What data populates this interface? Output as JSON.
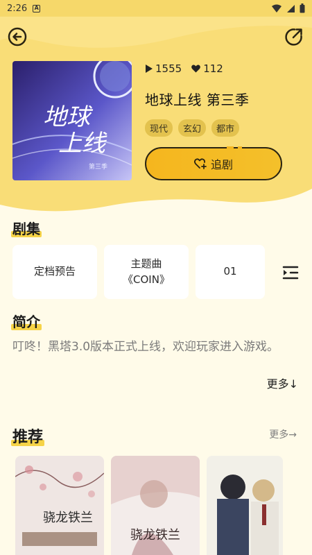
{
  "status_bar": {
    "time": "2:26",
    "notification_glyph": "A"
  },
  "header": {
    "back_icon": "back-arrow-circle-icon",
    "share_icon": "share-out-icon"
  },
  "drama": {
    "plays": "1555",
    "likes": "112",
    "title": "地球上线 第三季",
    "tags": [
      "现代",
      "玄幻",
      "都市"
    ],
    "follow_label": "追剧",
    "cover_text": [
      "地球",
      "上线"
    ],
    "cover_caption": "第三季"
  },
  "episodes": {
    "heading": "剧集",
    "items": [
      {
        "line1": "定档预告",
        "line2": ""
      },
      {
        "line1": "主题曲",
        "line2": "《COIN》"
      },
      {
        "line1": "01",
        "line2": ""
      }
    ]
  },
  "intro": {
    "heading": "简介",
    "text": "叮咚！黑塔3.0版本正式上线，欢迎玩家进入游戏。",
    "more_label": "更多↓"
  },
  "recommend": {
    "heading": "推荐",
    "more_label": "更多→",
    "items": [
      {
        "cover_text": "骁龙铁兰"
      },
      {
        "cover_text": "骁龙铁兰"
      },
      {
        "cover_text": ""
      }
    ]
  },
  "colors": {
    "accent": "#f6d347",
    "hero_bg": "#f9dd77",
    "page_bg": "#fffbe9",
    "tag_bg": "#e3c24e",
    "button_grad_start": "#f5b61e"
  }
}
